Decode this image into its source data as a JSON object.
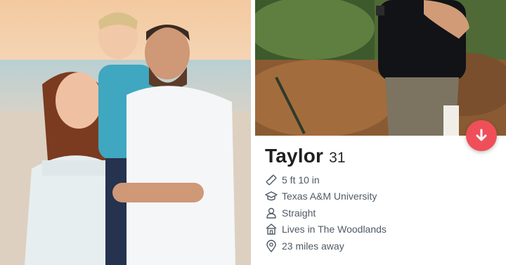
{
  "profile": {
    "name": "Taylor",
    "age": "31",
    "details": [
      {
        "icon": "ruler-icon",
        "text": "5 ft 10 in"
      },
      {
        "icon": "graduation-cap-icon",
        "text": "Texas A&M University"
      },
      {
        "icon": "person-icon",
        "text": "Straight"
      },
      {
        "icon": "house-icon",
        "text": "Lives in The Woodlands"
      },
      {
        "icon": "location-pin-icon",
        "text": "23 miles away"
      }
    ]
  },
  "actions": {
    "dislike_icon": "arrow-down-icon",
    "dislike_color": "#ef4f59"
  },
  "colors": {
    "text_primary": "#1f1f1f",
    "text_secondary": "#505965"
  }
}
